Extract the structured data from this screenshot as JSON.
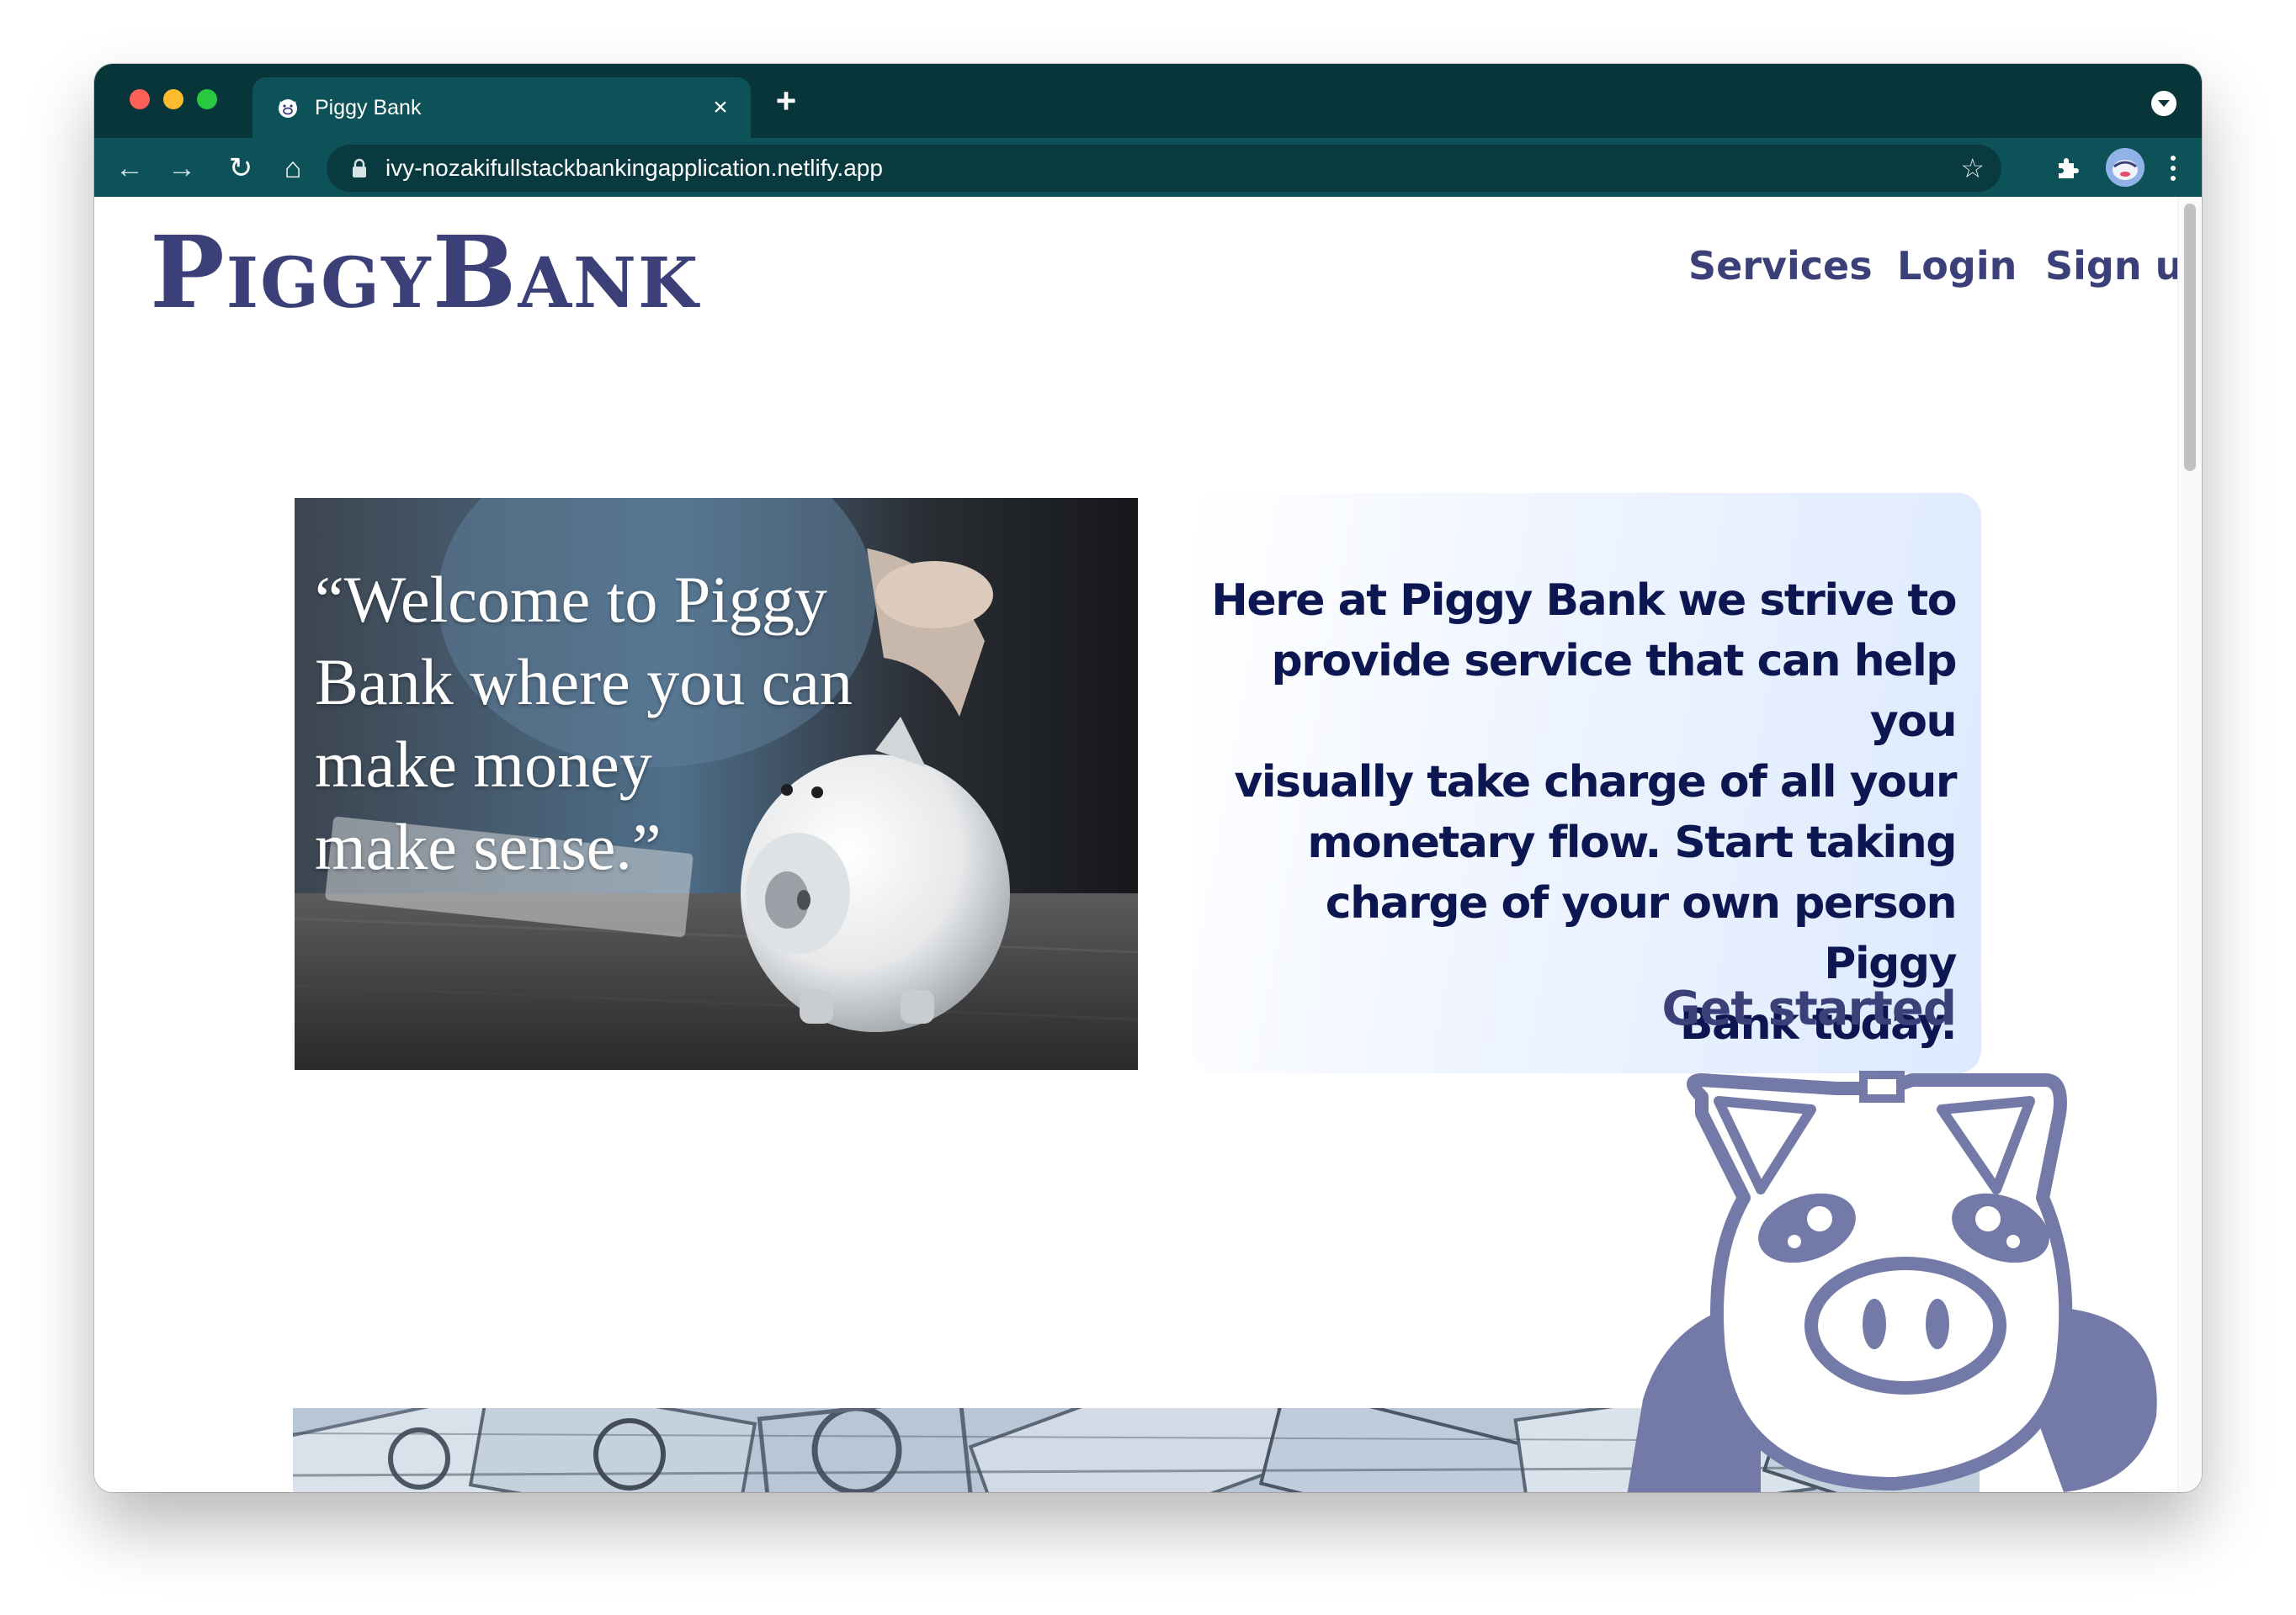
{
  "browser": {
    "tab_title": "Piggy Bank",
    "url": "ivy-nozakifullstackbankingapplication.netlify.app",
    "icons": {
      "close": "×",
      "new_tab": "+",
      "back": "←",
      "forward": "→",
      "reload": "↻",
      "home": "⌂",
      "star": "☆"
    }
  },
  "site": {
    "logo": {
      "p": "P",
      "iggy": "IGGY",
      "b": "B",
      "ank": "ANK"
    },
    "nav": {
      "services": "Services",
      "login": "Login",
      "signup": "Sign up"
    },
    "hero": {
      "quote_line1": "“Welcome to Piggy",
      "quote_line2": "Bank where you can",
      "quote_line3": "make money",
      "quote_line4": "make sense.”"
    },
    "info": {
      "line1": "Here at Piggy Bank we strive to",
      "line2": "provide service that can help you",
      "line3": "visually take charge of all your",
      "line4": "monetary flow. Start taking",
      "line5": "charge of your own person Piggy",
      "line6": "Bank today.",
      "cta": "Get started"
    }
  },
  "colors": {
    "titlebar": "#08353a",
    "toolbar": "#0d5258",
    "brand": "#3b4178",
    "heading": "#0c1752",
    "mascot": "#737aa8"
  }
}
